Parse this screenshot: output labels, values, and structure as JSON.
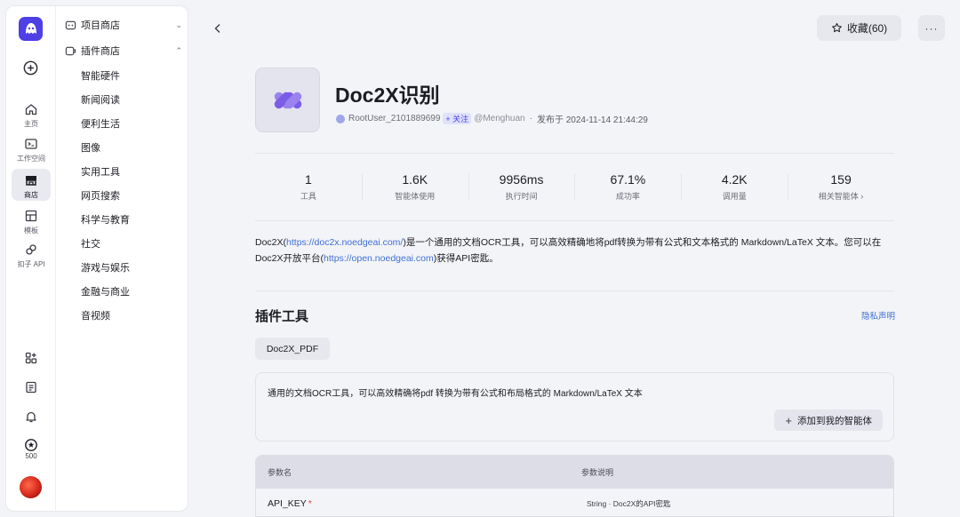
{
  "rail": {
    "items": [
      {
        "label": "主页",
        "icon": "home-icon"
      },
      {
        "label": "工作空间",
        "icon": "terminal-icon"
      },
      {
        "label": "商店",
        "icon": "store-icon"
      },
      {
        "label": "模板",
        "icon": "template-icon"
      },
      {
        "label": "扣子 API",
        "icon": "api-icon"
      }
    ],
    "credits": "500"
  },
  "nav": {
    "project_store": "项目商店",
    "plugin_store": "插件商店",
    "categories": [
      "智能硬件",
      "新闻阅读",
      "便利生活",
      "图像",
      "实用工具",
      "网页搜索",
      "科学与教育",
      "社交",
      "游戏与娱乐",
      "金融与商业",
      "音视频"
    ]
  },
  "header": {
    "favorite_label": "收藏(60)",
    "more_label": "···"
  },
  "plugin": {
    "name": "Doc2X识别",
    "author": "RootUser_2101889699",
    "follow": "+ 关注",
    "handle": "@Menghuan",
    "separator": "·",
    "published": "发布于 2024-11-14 21:44:29"
  },
  "stats": [
    {
      "value": "1",
      "label": "工具"
    },
    {
      "value": "1.6K",
      "label": "智能体使用"
    },
    {
      "value": "9956ms",
      "label": "执行时间"
    },
    {
      "value": "67.1%",
      "label": "成功率"
    },
    {
      "value": "4.2K",
      "label": "调用量"
    },
    {
      "value": "159",
      "label": "相关智能体 ›"
    }
  ],
  "description": {
    "p1": "Doc2X(",
    "link1": "https://doc2x.noedgeai.com/",
    "p2": ")是一个通用的文档OCR工具，可以高效精确地将pdf转换为带有公式和文本格式的 Markdown/LaTeX 文本。您可以在Doc2X开放平台(",
    "link2": "https://open.noedgeai.com",
    "p3": ")获得API密匙。"
  },
  "tools_section": {
    "title": "插件工具",
    "privacy": "隐私声明",
    "tab": "Doc2X_PDF",
    "tool_desc": "通用的文档OCR工具，可以高效精确将pdf 转换为带有公式和布局格式的 Markdown/LaTeX 文本",
    "add_button": "添加到我的智能体"
  },
  "params": {
    "col_name": "参数名",
    "col_desc": "参数说明",
    "rows": [
      {
        "name": "API_KEY",
        "required": "*",
        "desc": "String · Doc2X的API密匙"
      }
    ]
  },
  "colors": {
    "accent": "#4e40e5",
    "link": "#3f6fd8",
    "required": "#e5443b"
  }
}
